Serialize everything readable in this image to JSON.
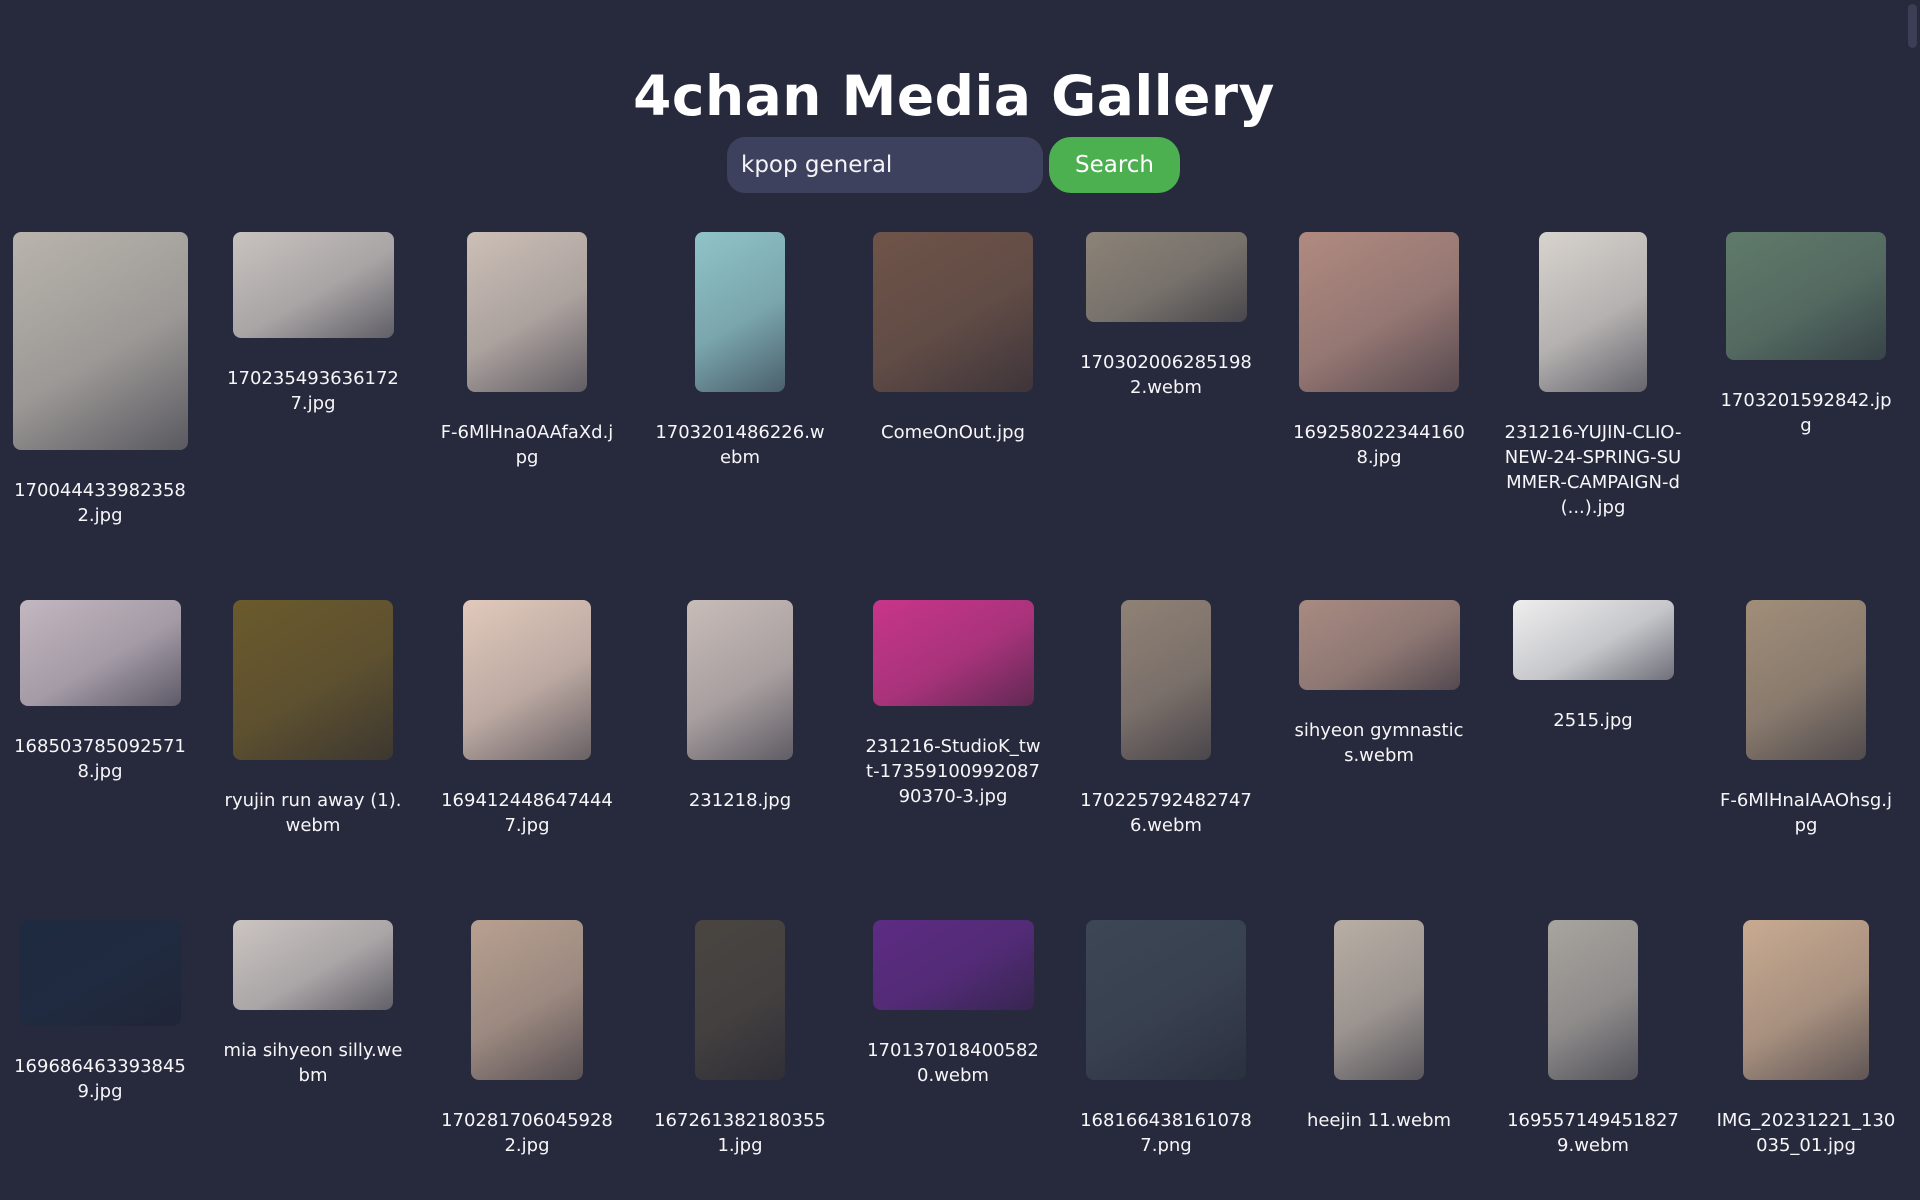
{
  "page": {
    "title": "4chan Media Gallery"
  },
  "search": {
    "value": "kpop general",
    "button_label": "Search"
  },
  "gallery": {
    "items": [
      {
        "filename": "1700444339823582.jpg",
        "color": "#b9b4ac"
      },
      {
        "filename": "1702354936361727.jpg",
        "color": "#c9c3bf"
      },
      {
        "filename": "F-6MlHna0AAfaXd.jpg",
        "color": "#ccbfb6"
      },
      {
        "filename": "1703201486226.webm",
        "color": "#8fc4c9"
      },
      {
        "filename": "ComeOnOut.jpg",
        "color": "#6f5448"
      },
      {
        "filename": "1703020062851982.webm",
        "color": "#8b8377"
      },
      {
        "filename": "1692580223441608.jpg",
        "color": "#b08a80"
      },
      {
        "filename": "231216-YUJIN-CLIO-NEW-24-SPRING-SUMMER-CAMPAIGN-d(...).jpg",
        "color": "#d8d3cd"
      },
      {
        "filename": "1703201592842.jpg",
        "color": "#5f7a6a"
      },
      {
        "filename": "1685037850925718.jpg",
        "color": "#c3b7c0"
      },
      {
        "filename": "ryujin run away (1).webm",
        "color": "#6b5a2c"
      },
      {
        "filename": "1694124486474447.jpg",
        "color": "#e1c9bb"
      },
      {
        "filename": "231218.jpg",
        "color": "#c8bcb8"
      },
      {
        "filename": "231216-StudioK_twt-1735910099208790370-3.jpg",
        "color": "#c8358a"
      },
      {
        "filename": "1702257924827476.webm",
        "color": "#8f8175"
      },
      {
        "filename": "sihyeon gymnastics.webm",
        "color": "#a88b81"
      },
      {
        "filename": "2515.jpg",
        "color": "#eeeeee"
      },
      {
        "filename": "F-6MlHnaIAAOhsg.jpg",
        "color": "#a18e79"
      },
      {
        "filename": "1696864633938459.jpg",
        "color": "#1e2a40"
      },
      {
        "filename": "mia sihyeon silly.webm",
        "color": "#cbc4c1"
      },
      {
        "filename": "1702817060459282.jpg",
        "color": "#b8a090"
      },
      {
        "filename": "1672613821803551.jpg",
        "color": "#4a4540"
      },
      {
        "filename": "1701370184005820.webm",
        "color": "#5d2b84"
      },
      {
        "filename": "1681664381610787.png",
        "color": "#3c4654"
      },
      {
        "filename": "heejin 11.webm",
        "color": "#b8aea4"
      },
      {
        "filename": "1695571494518279.webm",
        "color": "#a8a49e"
      },
      {
        "filename": "IMG_20231221_130035_01.jpg",
        "color": "#c8aa90"
      }
    ]
  }
}
